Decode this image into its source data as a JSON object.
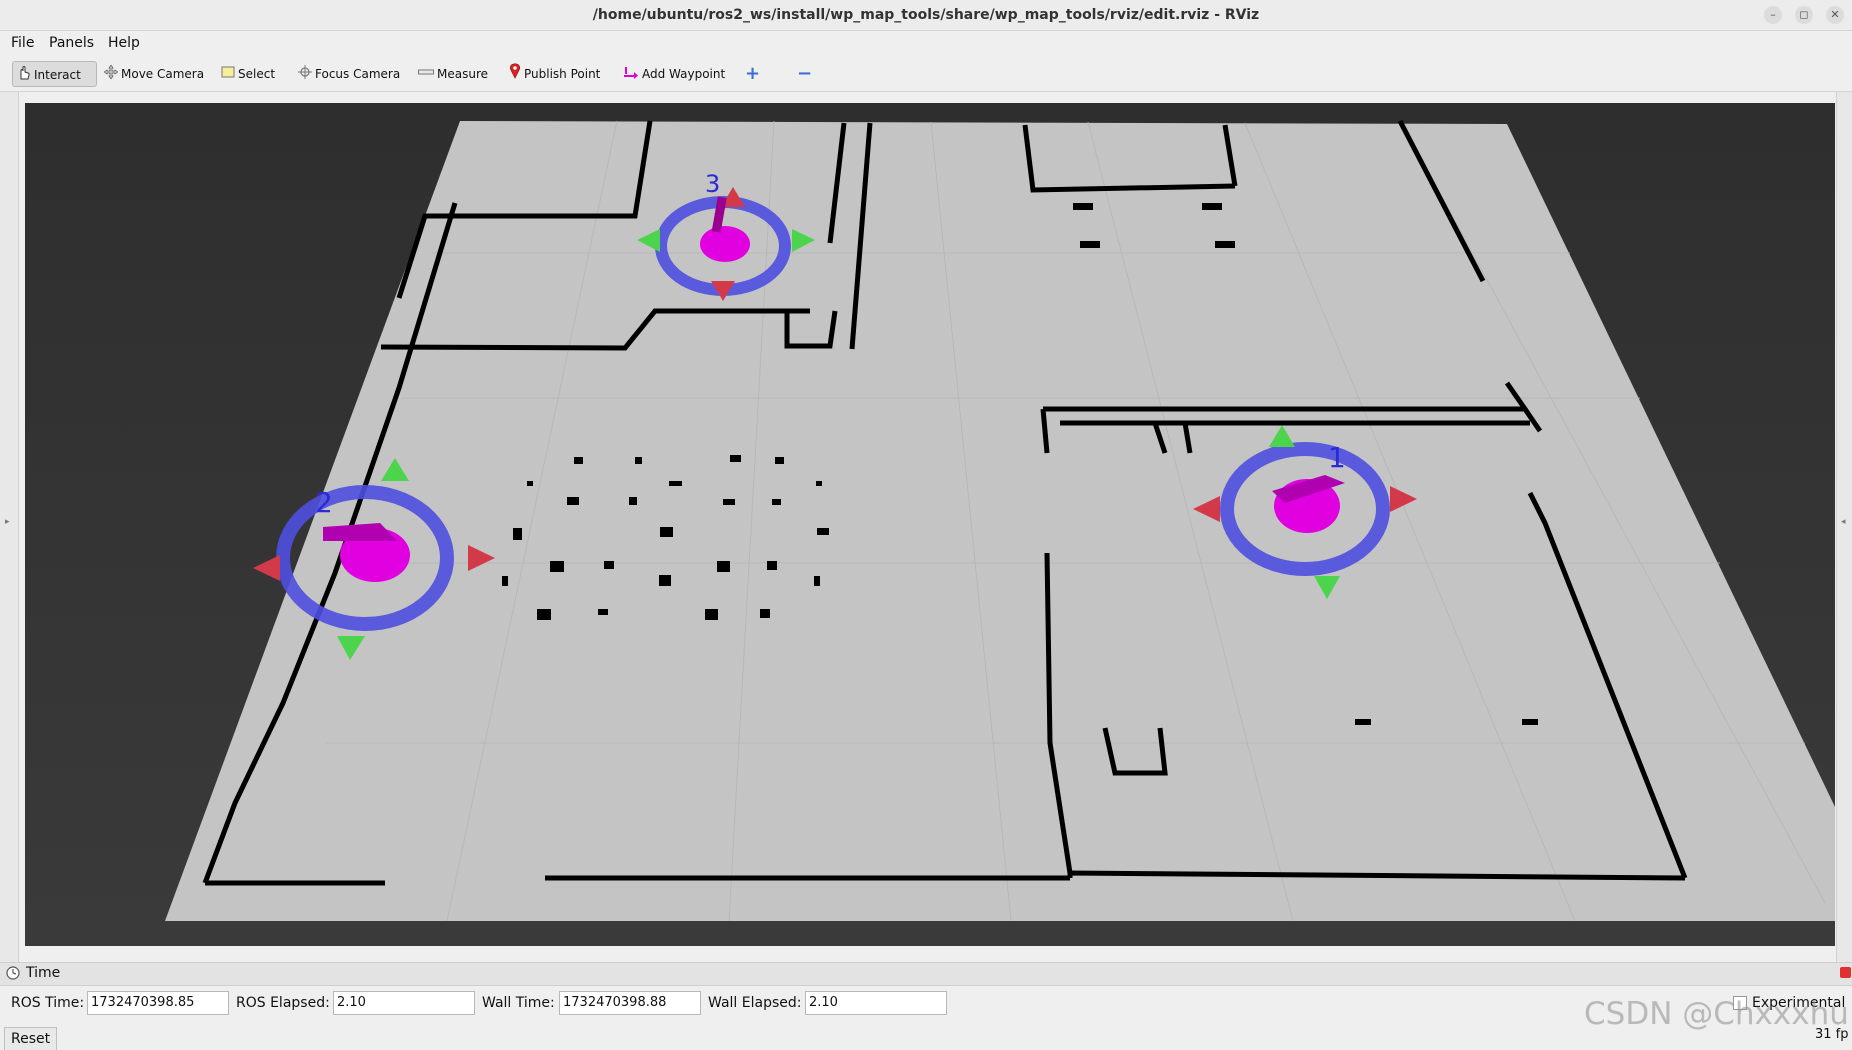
{
  "window": {
    "title": "/home/ubuntu/ros2_ws/install/wp_map_tools/share/wp_map_tools/rviz/edit.rviz - RViz",
    "minimize": "–",
    "restore": "◻",
    "close": "✕"
  },
  "menu": {
    "file": "File",
    "panels": "Panels",
    "help": "Help"
  },
  "toolbar": {
    "interact": "Interact",
    "move_camera": "Move Camera",
    "select": "Select",
    "focus_camera": "Focus Camera",
    "measure": "Measure",
    "publish_point": "Publish Point",
    "add_waypoint": "Add Waypoint",
    "add_tool": "+",
    "remove_tool": "−"
  },
  "viewport": {
    "waypoints": [
      {
        "label": "1"
      },
      {
        "label": "2"
      },
      {
        "label": "3"
      }
    ],
    "colors": {
      "background": "#323232",
      "map_floor": "#c4c4c4",
      "wall": "#000000",
      "waypoint_body": "#e000e0",
      "ring": "#4f4fe0",
      "arrow_red": "#d23a4a",
      "arrow_green": "#4cd44c"
    }
  },
  "time_panel": {
    "title": "Time",
    "ros_time_label": "ROS Time:",
    "ros_time_value": "1732470398.85",
    "ros_elapsed_label": "ROS Elapsed:",
    "ros_elapsed_value": "2.10",
    "wall_time_label": "Wall Time:",
    "wall_time_value": "1732470398.88",
    "wall_elapsed_label": "Wall Elapsed:",
    "wall_elapsed_value": "2.10",
    "experimental_label": "Experimental",
    "reset_label": "Reset",
    "fps": "31 fp"
  },
  "watermark": "CSDN @Chxxxhu"
}
